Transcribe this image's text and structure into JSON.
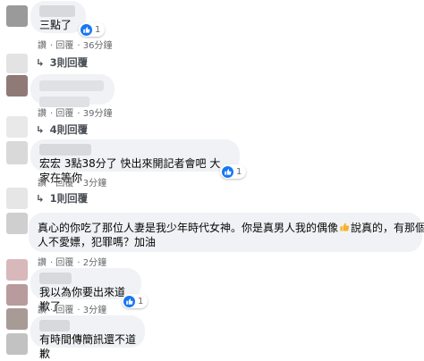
{
  "comments": [
    {
      "text": "三點了",
      "reactions": "1",
      "actions": [
        "讚",
        "回覆",
        "36分鐘"
      ]
    },
    {
      "actions": [
        "讚",
        "回覆",
        "39分鐘"
      ]
    },
    {
      "text": "宏宏 3點38分了 快出來開記者會吧 大家在等你",
      "reactions": "1",
      "actions": [
        "讚",
        "回覆",
        "3分鐘"
      ]
    },
    {
      "text_line1": "真心的你吃了那位人妻是我少年時代女神。你是真男人我的偶像",
      "emoji_name": "thumbs-up-emoji",
      "text_line1_tail": "說真的，有那個男",
      "text_line2": "人不愛嫖，犯罪嗎？加油",
      "actions": [
        "讚",
        "回覆",
        "2分鐘"
      ]
    },
    {
      "text": "我以為你要出來道歉了",
      "reactions": "1",
      "actions": [
        "讚",
        "回覆",
        "3分鐘"
      ]
    },
    {
      "text": "有時間傳簡訊還不道歉"
    }
  ],
  "replies": [
    "3則回覆",
    "4則回覆",
    "1則回覆"
  ],
  "colors": {
    "bubble": "#f0f2f5",
    "meta": "#65676b",
    "like": "#1877f2"
  }
}
